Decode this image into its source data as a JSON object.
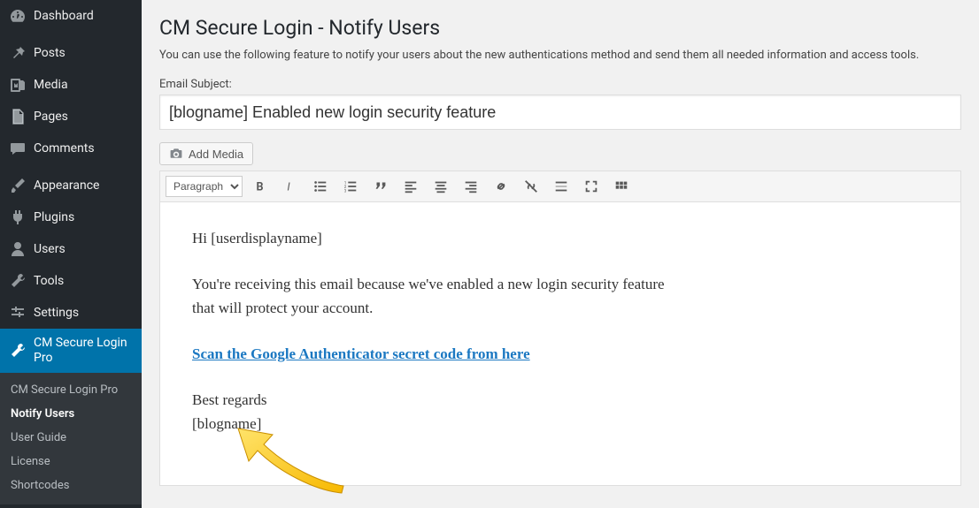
{
  "sidebar": {
    "items": [
      {
        "label": "Dashboard",
        "icon": "gauge-icon"
      },
      {
        "label": "Posts",
        "icon": "pin-icon"
      },
      {
        "label": "Media",
        "icon": "media-icon"
      },
      {
        "label": "Pages",
        "icon": "page-icon"
      },
      {
        "label": "Comments",
        "icon": "comment-icon"
      },
      {
        "label": "Appearance",
        "icon": "brush-icon"
      },
      {
        "label": "Plugins",
        "icon": "plug-icon"
      },
      {
        "label": "Users",
        "icon": "user-icon"
      },
      {
        "label": "Tools",
        "icon": "wrench-icon"
      },
      {
        "label": "Settings",
        "icon": "sliders-icon"
      },
      {
        "label": "CM Secure Login Pro",
        "icon": "wrench-icon",
        "current": true
      }
    ],
    "submenu": [
      {
        "label": "CM Secure Login Pro"
      },
      {
        "label": "Notify Users",
        "active": true
      },
      {
        "label": "User Guide"
      },
      {
        "label": "License"
      },
      {
        "label": "Shortcodes"
      }
    ]
  },
  "page": {
    "title": "CM Secure Login - Notify Users",
    "description": "You can use the following feature to notify your users about the new authentications method and send them all needed information and access tools.",
    "subject_label": "Email Subject:",
    "subject_value": "[blogname] Enabled new login security feature",
    "add_media_label": "Add Media"
  },
  "editor": {
    "format_selected": "Paragraph",
    "body": {
      "greeting": "Hi [userdisplayname]",
      "para1": "You're receiving this email because we've enabled a new login security feature that will protect your account.",
      "link_text": "Scan the Google Authenticator secret code from here",
      "signoff1": "Best regards",
      "signoff2": "[blogname]"
    }
  }
}
